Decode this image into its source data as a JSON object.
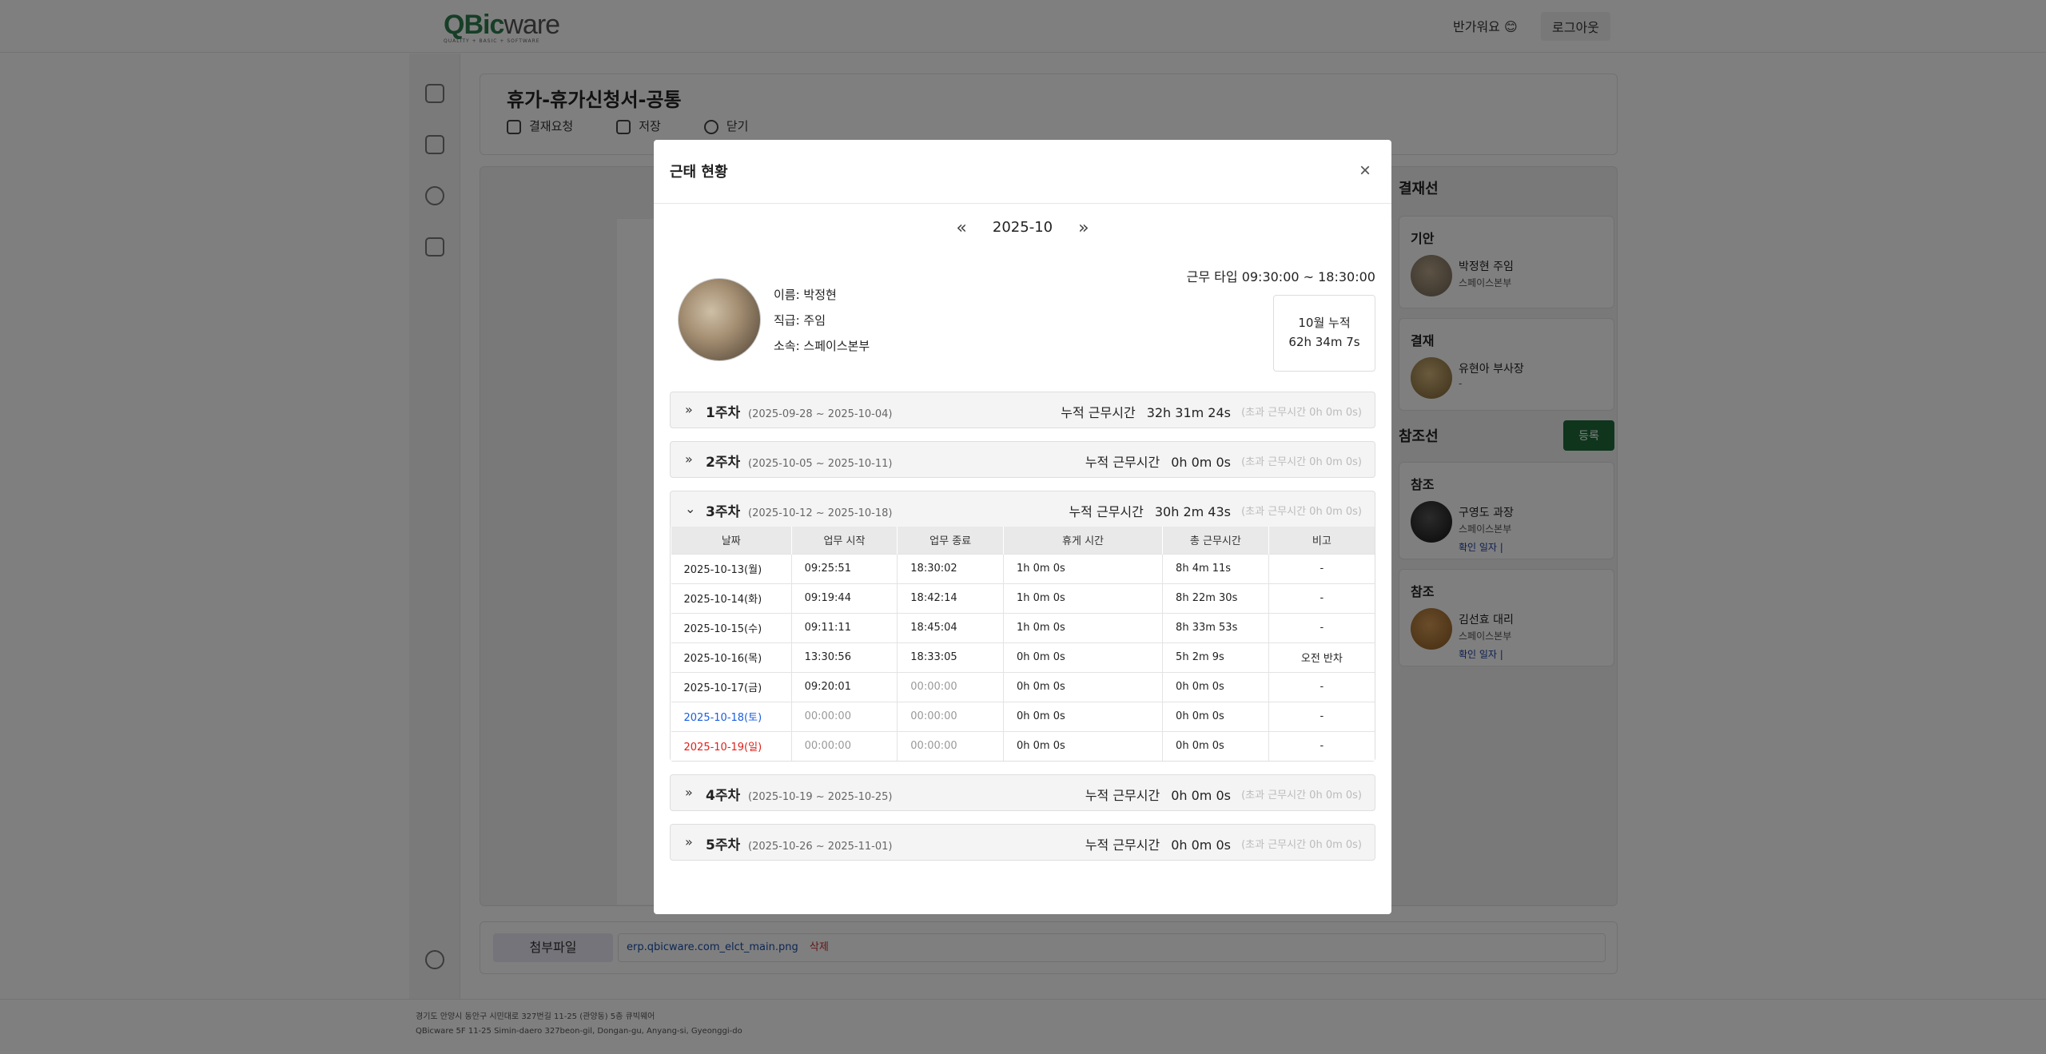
{
  "header": {
    "logo_main": "QBic",
    "logo_ware": "ware",
    "logo_tagline": "QUALITY + BASIC + SOFTWARE",
    "greeting": "반가워요 😊",
    "logout_label": "로그아웃"
  },
  "document": {
    "title": "휴가-휴가신청서-공통",
    "actions": [
      {
        "label": "결재요청",
        "icon": "edit-icon"
      },
      {
        "label": "저장",
        "icon": "download-icon"
      },
      {
        "label": "닫기",
        "icon": "close-circle-icon"
      }
    ]
  },
  "approval": {
    "title": "결재선",
    "cards": [
      {
        "title": "기안",
        "name": "박정현  주임",
        "dept": "스페이스본부",
        "confirm": ""
      },
      {
        "title": "결재",
        "name": "유현아  부사장",
        "dept": "-",
        "confirm": ""
      }
    ],
    "ref_title": "참조선",
    "ref_button": "등록",
    "refs": [
      {
        "title": "참조",
        "name": "구영도  과장",
        "dept": "스페이스본부",
        "confirm": "확인 일자 |"
      },
      {
        "title": "참조",
        "name": "김선효  대리",
        "dept": "스페이스본부",
        "confirm": "확인 일자 |"
      }
    ]
  },
  "attachment": {
    "label": "첨부파일",
    "file_name": "erp.qbicware.com_elct_main.png",
    "delete_label": "삭제"
  },
  "footer": {
    "address_ko": "경기도 안양시 동안구 시민대로 327번길 11-25 (관양동) 5층 큐빅웨어",
    "address_en": "QBicware 5F 11-25 Simin-daero 327beon-gil, Dongan-gu, Anyang-si, Gyeonggi-do"
  },
  "modal": {
    "title": "근태 현황",
    "close_symbol": "×",
    "prev_symbol": "«",
    "next_symbol": "»",
    "month": "2025-10",
    "profile": {
      "name": "이름: 박정현",
      "rank": "직급: 주임",
      "dept": "소속: 스페이스본부"
    },
    "work_type": "근무 타입  09:30:00 ~ 18:30:00",
    "monthly_label": "10월 누적",
    "monthly_value": "62h 34m 7s",
    "cum_label": "누적 근무시간",
    "columns": [
      "날짜",
      "업무 시작",
      "업무 종료",
      "휴게 시간",
      "총 근무시간",
      "비고"
    ],
    "weeks": [
      {
        "name": "1주차",
        "range": "(2025-09-28 ~ 2025-10-04)",
        "cum": "32h 31m 24s",
        "over": "(초과 근무시간 0h 0m 0s)",
        "expanded": false
      },
      {
        "name": "2주차",
        "range": "(2025-10-05 ~ 2025-10-11)",
        "cum": "0h 0m 0s",
        "over": "(초과 근무시간 0h 0m 0s)",
        "expanded": false
      },
      {
        "name": "3주차",
        "range": "(2025-10-12 ~ 2025-10-18)",
        "cum": "30h 2m 43s",
        "over": "(초과 근무시간 0h 0m 0s)",
        "expanded": true,
        "rows": [
          {
            "date": "2025-10-13(월)",
            "start": "09:25:51",
            "end": "18:30:02",
            "break": "1h 0m 0s",
            "total": "8h 4m 11s",
            "note": "-",
            "day": "weekday"
          },
          {
            "date": "2025-10-14(화)",
            "start": "09:19:44",
            "end": "18:42:14",
            "break": "1h 0m 0s",
            "total": "8h 22m 30s",
            "note": "-",
            "day": "weekday"
          },
          {
            "date": "2025-10-15(수)",
            "start": "09:11:11",
            "end": "18:45:04",
            "break": "1h 0m 0s",
            "total": "8h 33m 53s",
            "note": "-",
            "day": "weekday"
          },
          {
            "date": "2025-10-16(목)",
            "start": "13:30:56",
            "end": "18:33:05",
            "break": "0h 0m 0s",
            "total": "5h 2m 9s",
            "note": "오전 반차",
            "day": "weekday"
          },
          {
            "date": "2025-10-17(금)",
            "start": "09:20:01",
            "end": "00:00:00",
            "break": "0h 0m 0s",
            "total": "0h 0m 0s",
            "note": "-",
            "day": "weekday"
          },
          {
            "date": "2025-10-18(토)",
            "start": "00:00:00",
            "end": "00:00:00",
            "break": "0h 0m 0s",
            "total": "0h 0m 0s",
            "note": "-",
            "day": "sat"
          },
          {
            "date": "2025-10-19(일)",
            "start": "00:00:00",
            "end": "00:00:00",
            "break": "0h 0m 0s",
            "total": "0h 0m 0s",
            "note": "-",
            "day": "sun"
          }
        ]
      },
      {
        "name": "4주차",
        "range": "(2025-10-19 ~ 2025-10-25)",
        "cum": "0h 0m 0s",
        "over": "(초과 근무시간 0h 0m 0s)",
        "expanded": false
      },
      {
        "name": "5주차",
        "range": "(2025-10-26 ~ 2025-11-01)",
        "cum": "0h 0m 0s",
        "over": "(초과 근무시간 0h 0m 0s)",
        "expanded": false
      }
    ]
  },
  "colors": {
    "brand_green": "#2e7d4f",
    "register_button": "#1f6b3a",
    "saturday": "#1a5ee0",
    "sunday": "#e0201a",
    "link_blue": "#1a4ea8",
    "delete_red": "#c72c2c"
  }
}
